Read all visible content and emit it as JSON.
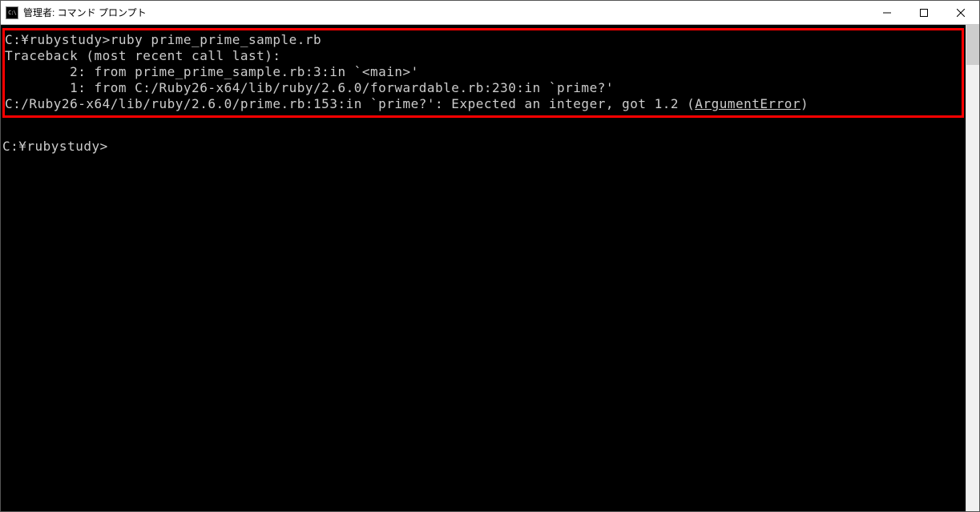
{
  "window": {
    "title": "管理者: コマンド プロンプト"
  },
  "terminal": {
    "highlighted": {
      "line1": "C:¥rubystudy>ruby prime_prime_sample.rb",
      "line2": "Traceback (most recent call last):",
      "line3": "        2: from prime_prime_sample.rb:3:in `<main>'",
      "line4": "        1: from C:/Ruby26-x64/lib/ruby/2.6.0/forwardable.rb:230:in `prime?'",
      "line5_pre": "C:/Ruby26-x64/lib/ruby/2.6.0/prime.rb:153:in `prime?': Expected an integer, got 1.2 (",
      "line5_err": "ArgumentError",
      "line5_post": ")"
    },
    "prompt": "C:¥rubystudy>"
  }
}
